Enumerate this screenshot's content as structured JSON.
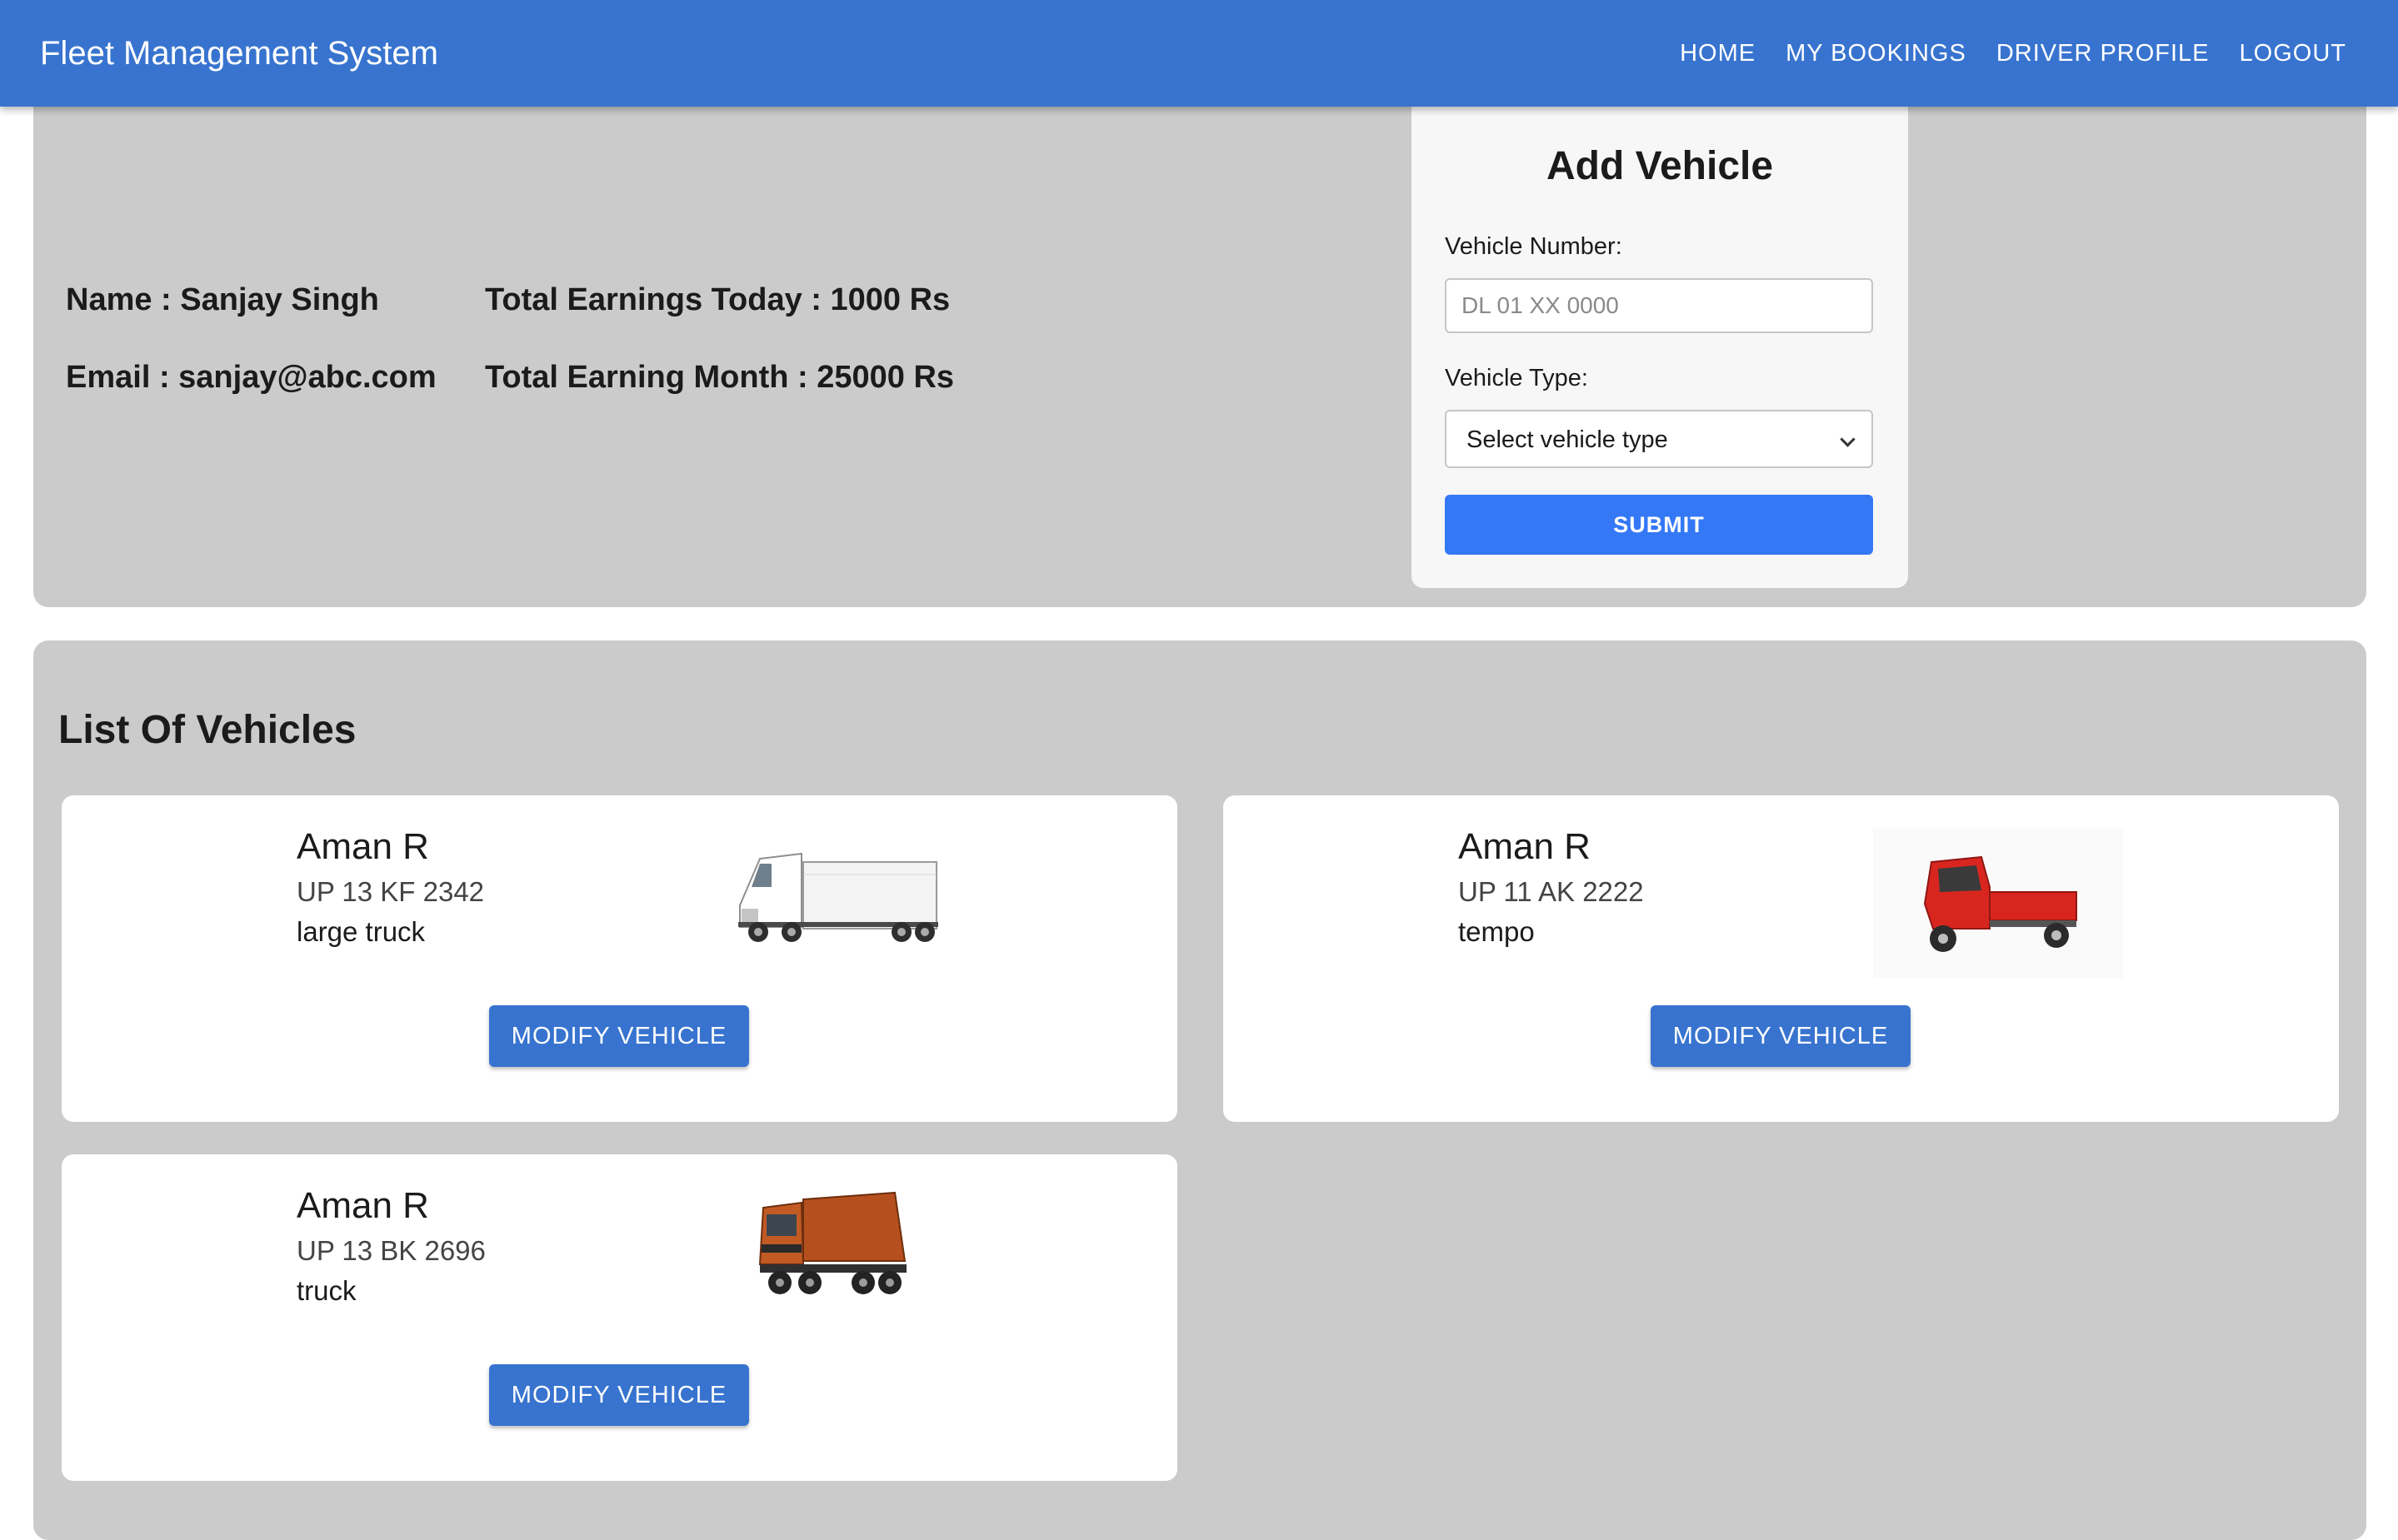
{
  "app": {
    "title": "Fleet Management System",
    "nav": [
      "HOME",
      "MY BOOKINGS",
      "DRIVER PROFILE",
      "LOGOUT"
    ]
  },
  "profile": {
    "name": "Name : Sanjay Singh",
    "email": "Email : sanjay@abc.com",
    "earnings_today": "Total Earnings Today : 1000 Rs",
    "earnings_month": "Total Earning Month : 25000 Rs"
  },
  "add_vehicle": {
    "title": "Add Vehicle",
    "number_label": "Vehicle Number:",
    "number_placeholder": "DL 01 XX 0000",
    "number_value": "",
    "type_label": "Vehicle Type:",
    "type_selected": "Select vehicle type",
    "submit_label": "SUBMIT"
  },
  "vehicles": {
    "title": "List Of Vehicles",
    "items": [
      {
        "owner": "Aman R",
        "number": "UP 13 KF 2342",
        "type": "large truck",
        "icon": "semi-truck-image",
        "button": "MODIFY VEHICLE"
      },
      {
        "owner": "Aman R",
        "number": "UP 11 AK 2222",
        "type": "tempo",
        "icon": "tempo-image",
        "button": "MODIFY VEHICLE"
      },
      {
        "owner": "Aman R",
        "number": "UP 13 BK 2696",
        "type": "truck",
        "icon": "dump-truck-image",
        "button": "MODIFY VEHICLE"
      }
    ]
  },
  "colors": {
    "appbar": "#3874cf",
    "panel": "#cbcbcb",
    "submit": "#3478f6",
    "button": "#3874cf"
  }
}
